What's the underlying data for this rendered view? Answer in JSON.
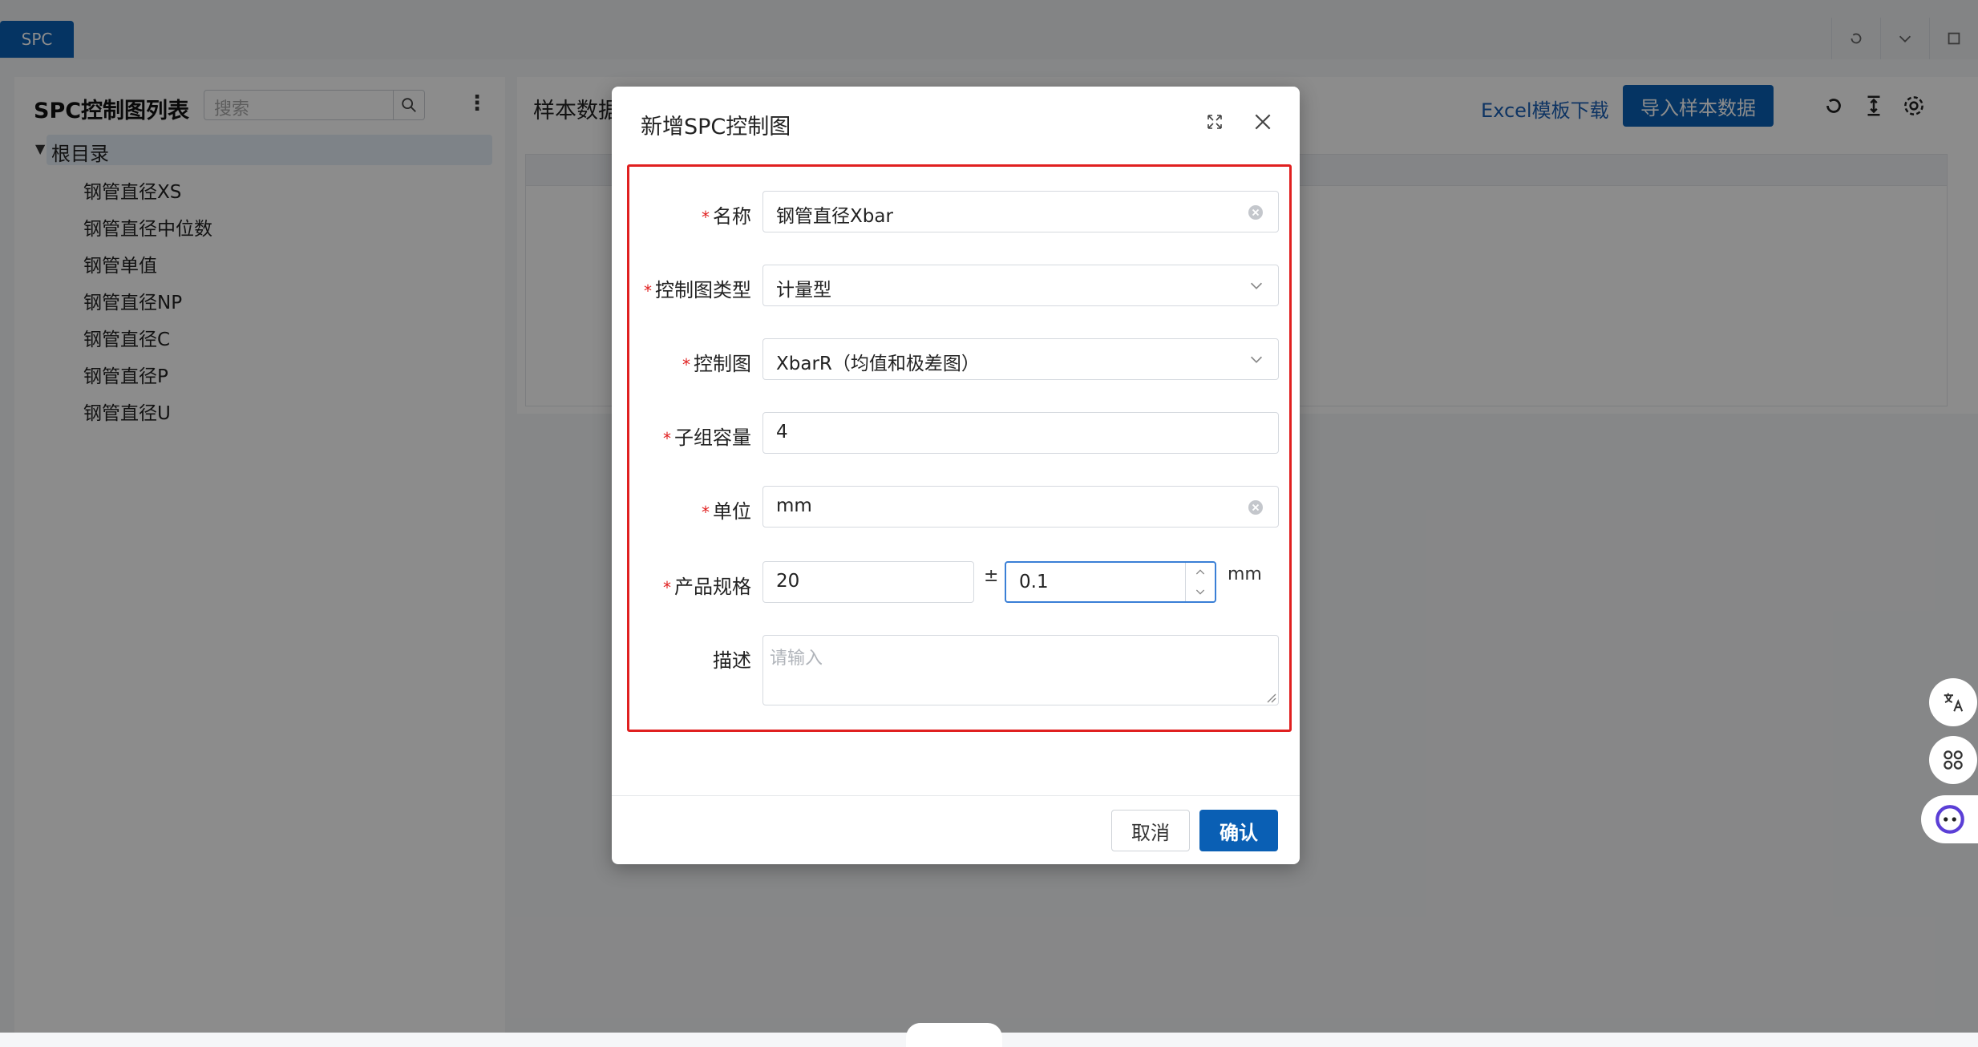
{
  "tabbar": {
    "tab": "SPC"
  },
  "left_panel": {
    "title": "SPC控制图列表",
    "search_placeholder": "搜索",
    "tree": {
      "root": "根目录",
      "items": [
        "钢管直径XS",
        "钢管直径中位数",
        "钢管单值",
        "钢管直径NP",
        "钢管直径C",
        "钢管直径P",
        "钢管直径U"
      ]
    }
  },
  "main_panel": {
    "title": "样本数据",
    "excel_link": "Excel模板下载",
    "import_button": "导入样本数据"
  },
  "dialog": {
    "title": "新增SPC控制图",
    "fields": {
      "name": {
        "label": "名称",
        "value": "钢管直径Xbar"
      },
      "chart_type": {
        "label": "控制图类型",
        "value": "计量型"
      },
      "chart": {
        "label": "控制图",
        "value": "XbarR（均值和极差图）"
      },
      "subgroup": {
        "label": "子组容量",
        "value": "4"
      },
      "unit": {
        "label": "单位",
        "value": "mm"
      },
      "spec": {
        "label": "产品规格",
        "nominal": "20",
        "pm": "±",
        "tolerance": "0.1",
        "unit": "mm"
      },
      "description": {
        "label": "描述",
        "placeholder": "请输入"
      }
    },
    "cancel": "取消",
    "confirm": "确认"
  },
  "colors": {
    "primary": "#0a5fb4",
    "required": "#e02020",
    "highlight_box": "#e02020"
  }
}
